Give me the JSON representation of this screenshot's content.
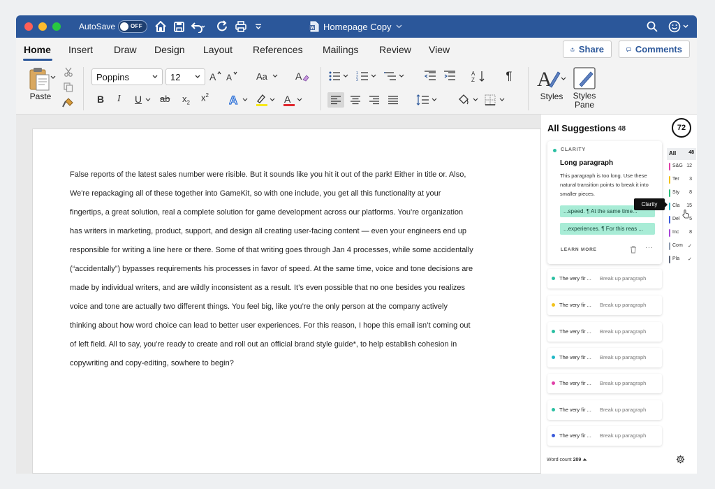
{
  "titlebar": {
    "autosave_label": "AutoSave",
    "autosave_state": "OFF",
    "document_title": "Homepage Copy"
  },
  "menu": {
    "tabs": [
      "Home",
      "Insert",
      "Draw",
      "Design",
      "Layout",
      "References",
      "Mailings",
      "Review",
      "View"
    ],
    "active_tab": "Home",
    "share_label": "Share",
    "comments_label": "Comments"
  },
  "ribbon": {
    "paste_label": "Paste",
    "font_name": "Poppins",
    "font_size": "12",
    "styles_label": "Styles",
    "styles_pane_label": "Styles\nPane"
  },
  "document": {
    "body": "False reports of the latest sales number were risible. But it sounds like you hit it out of the park! Either in title or. Also, We're repackaging all of these together into GameKit, so with one include, you get all this functionality at your fingertips, a great solution, real a complete solution for game development across our platforms. You’re organization has writers in marketing, product, support, and design all creating user-facing content — even your engineers end up responsible for writing a line here or there. Some of that writing goes through Jan 4 processes, while some accidentally (“accidentally”) bypasses requirements his processes in favor of speed. At the same time, voice and tone decisions are made by individual writers, and are wildly inconsistent as a result. It’s even possible that no one besides you realizes voice and tone are actually two different things. You feel big, like you’re the only person at the company actively thinking about how word choice can lead to better user experiences. For this reason, I hope this email isn’t coming out of left field. All to say, you’re ready to create and roll out an official brand style guide*, to help establish cohesion in copywriting and copy-editing, sowhere to begin?"
  },
  "panel": {
    "title": "All Suggestions",
    "count": "48",
    "score": "72",
    "card": {
      "category": "CLARITY",
      "title": "Long paragraph",
      "description": "This paragraph is too long. Use these natural transition points to break it into smaller pieces.",
      "chip1": "...speed. ¶ At the same time...",
      "chip2": "...experiences. ¶ For this reas ...",
      "learn_more": "LEARN MORE",
      "more": "···",
      "accent": "#2bbfa2"
    },
    "tooltip": "Clarity",
    "filters": [
      {
        "label": "All",
        "count": "48",
        "color": ""
      },
      {
        "label": "S&G",
        "count": "12",
        "color": "#e040a8"
      },
      {
        "label": "Ter",
        "count": "3",
        "color": "#f2c21b"
      },
      {
        "label": "Sty",
        "count": "8",
        "color": "#2bbf7a"
      },
      {
        "label": "Cla",
        "count": "15",
        "color": "#20b8c6"
      },
      {
        "label": "Del",
        "count": "5",
        "color": "#3b5bdb"
      },
      {
        "label": "Inc",
        "count": "8",
        "color": "#a846d8"
      },
      {
        "label": "Com",
        "count": "✓",
        "color": "#8e9bb0"
      },
      {
        "label": "Pla",
        "count": "✓",
        "color": "#5a6478"
      }
    ],
    "rows": [
      {
        "text": "The very fir ...",
        "action": "Break up paragraph",
        "color": "#2bbfa2"
      },
      {
        "text": "The very fir ...",
        "action": "Break up paragraph",
        "color": "#f2c21b"
      },
      {
        "text": "The very fir ...",
        "action": "Break up paragraph",
        "color": "#2bbfa2"
      },
      {
        "text": "The very fir ...",
        "action": "Break up paragraph",
        "color": "#20b8c6"
      },
      {
        "text": "The very fir ...",
        "action": "Break up paragraph",
        "color": "#e040a8"
      },
      {
        "text": "The very fir ...",
        "action": "Break up paragraph",
        "color": "#2bbfa2"
      },
      {
        "text": "The very fir ...",
        "action": "Break up paragraph",
        "color": "#3b5bdb"
      }
    ],
    "word_count_label": "Word count",
    "word_count": "209"
  }
}
